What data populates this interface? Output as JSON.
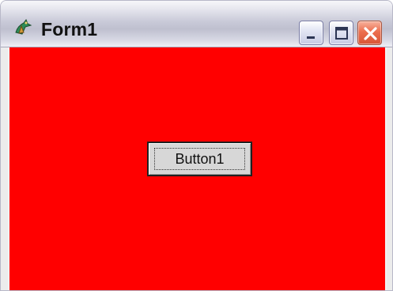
{
  "window": {
    "title": "Form1",
    "client_background": "#FF0000",
    "controls": {
      "minimize_icon": "minimize-icon",
      "maximize_icon": "maximize-icon",
      "close_icon": "close-icon"
    },
    "app_icon": "delphi-app-icon"
  },
  "form": {
    "button_label": "Button1"
  }
}
